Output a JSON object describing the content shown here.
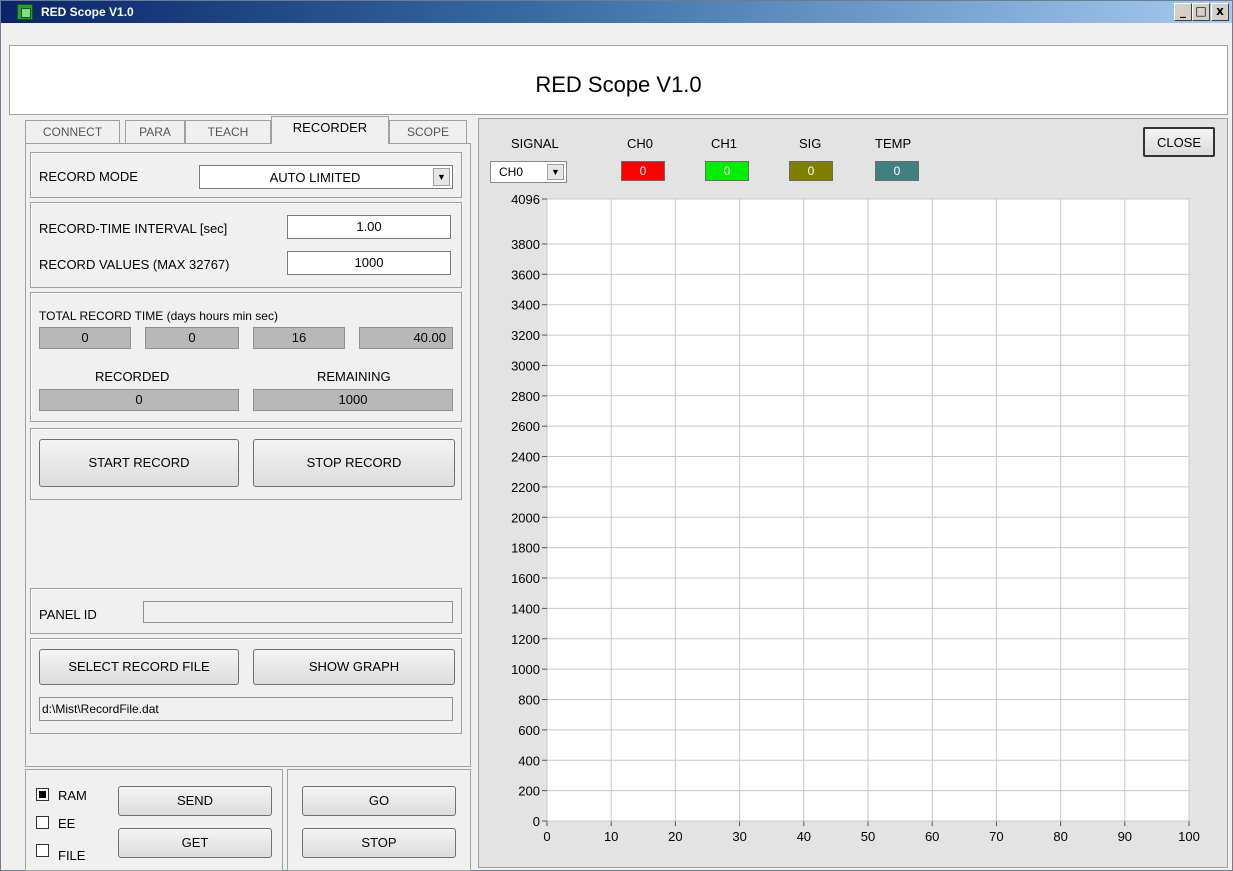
{
  "window": {
    "title": "RED Scope V1.0",
    "controls": [
      "_",
      "□",
      "x"
    ]
  },
  "banner": {
    "title": "RED Scope V1.0"
  },
  "tabs": [
    {
      "label": "CONNECT",
      "active": false
    },
    {
      "label": "PARA",
      "active": false
    },
    {
      "label": "TEACH",
      "active": false
    },
    {
      "label": "RECORDER",
      "active": true
    },
    {
      "label": "SCOPE",
      "active": false
    }
  ],
  "recorder": {
    "record_mode_label": "RECORD MODE",
    "record_mode_value": "AUTO LIMITED",
    "interval_label": "RECORD-TIME INTERVAL [sec]",
    "interval_value": "1.00",
    "values_label": "RECORD VALUES (MAX 32767)",
    "values_value": "1000",
    "total_time_label": "TOTAL RECORD TIME (days  hours  min sec)",
    "total_time": {
      "days": "0",
      "hours": "0",
      "min": "16",
      "sec": "40.00"
    },
    "recorded_label": "RECORDED",
    "recorded_value": "0",
    "remaining_label": "REMAINING",
    "remaining_value": "1000",
    "start_button": "START RECORD",
    "stop_button": "STOP RECORD",
    "panel_id_label": "PANEL ID",
    "panel_id_value": "",
    "select_file_button": "SELECT RECORD FILE",
    "show_graph_button": "SHOW GRAPH",
    "file_path": "d:\\Mist\\RecordFile.dat"
  },
  "bottom": {
    "ram_label": "RAM",
    "ee_label": "EE",
    "file_label": "FILE",
    "ram_checked": true,
    "ee_checked": false,
    "file_checked": false,
    "send_button": "SEND",
    "get_button": "GET",
    "go_button": "GO",
    "stop_button": "STOP"
  },
  "scope": {
    "signal_label": "SIGNAL",
    "signal_value": "CH0",
    "close_button": "CLOSE",
    "indicators": [
      {
        "label": "CH0",
        "value": "0",
        "color": "#ff0000"
      },
      {
        "label": "CH1",
        "value": "0",
        "color": "#00ee00"
      },
      {
        "label": "SIG",
        "value": "0",
        "color": "#808000"
      },
      {
        "label": "TEMP",
        "value": "0",
        "color": "#408080"
      }
    ]
  },
  "chart_data": {
    "type": "line",
    "title": "",
    "xlabel": "",
    "ylabel": "",
    "xlim": [
      0,
      100
    ],
    "ylim": [
      0,
      4096
    ],
    "x_ticks": [
      0,
      10,
      20,
      30,
      40,
      50,
      60,
      70,
      80,
      90,
      100
    ],
    "y_ticks": [
      0,
      200,
      400,
      600,
      800,
      1000,
      1200,
      1400,
      1600,
      1800,
      2000,
      2200,
      2400,
      2600,
      2800,
      3000,
      3200,
      3400,
      3600,
      3800,
      4096
    ],
    "grid": true,
    "series": []
  }
}
